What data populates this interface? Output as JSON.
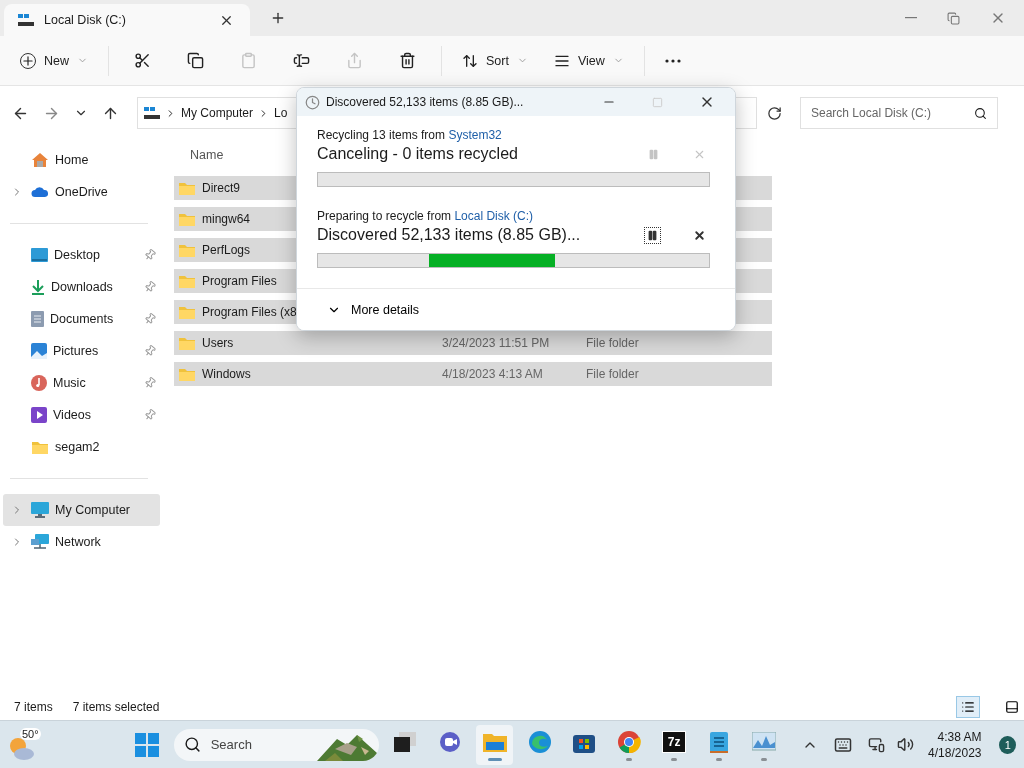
{
  "window": {
    "tab_title": "Local Disk (C:)"
  },
  "toolbar": {
    "new_label": "New",
    "tools": [
      {
        "disabled": false
      },
      {
        "disabled": false
      },
      {
        "disabled": true
      },
      {
        "disabled": false
      },
      {
        "disabled": true
      },
      {
        "disabled": false
      }
    ],
    "sort_label": "Sort",
    "view_label": "View"
  },
  "address": {
    "crumbs": [
      "My Computer",
      "Lo"
    ]
  },
  "search": {
    "placeholder": "Search Local Disk (C:)"
  },
  "sidebar": {
    "groups": [
      [
        {
          "label": "Home",
          "pinned": false,
          "selected": false,
          "has_children": false
        },
        {
          "label": "OneDrive",
          "pinned": false,
          "selected": false,
          "has_children": true
        }
      ],
      [
        {
          "label": "Desktop",
          "pinned": true,
          "selected": false,
          "has_children": false
        },
        {
          "label": "Downloads",
          "pinned": true,
          "selected": false,
          "has_children": false
        },
        {
          "label": "Documents",
          "pinned": true,
          "selected": false,
          "has_children": false
        },
        {
          "label": "Pictures",
          "pinned": true,
          "selected": false,
          "has_children": false
        },
        {
          "label": "Music",
          "pinned": true,
          "selected": false,
          "has_children": false
        },
        {
          "label": "Videos",
          "pinned": true,
          "selected": false,
          "has_children": false
        },
        {
          "label": "segam2",
          "pinned": false,
          "selected": false,
          "has_children": false
        }
      ],
      [
        {
          "label": "My Computer",
          "pinned": false,
          "selected": true,
          "has_children": true
        },
        {
          "label": "Network",
          "pinned": false,
          "selected": false,
          "has_children": true
        }
      ]
    ]
  },
  "file_list": {
    "columns": [
      "Name"
    ],
    "rows": [
      {
        "name": "Direct9",
        "selected": true
      },
      {
        "name": "mingw64",
        "selected": true
      },
      {
        "name": "PerfLogs",
        "selected": true
      },
      {
        "name": "Program Files",
        "selected": true
      },
      {
        "name": "Program Files (x8",
        "selected": true
      },
      {
        "name": "Users",
        "date": "3/24/2023 11:51 PM",
        "type": "File folder",
        "selected": true
      },
      {
        "name": "Windows",
        "date": "4/18/2023 4:13 AM",
        "type": "File folder",
        "selected": true
      }
    ]
  },
  "status_bar": {
    "item_count": "7 items",
    "selection": "7 items selected",
    "views": [
      {
        "selected": true
      },
      {
        "selected": false
      }
    ]
  },
  "dialog": {
    "title": "Discovered 52,133 items (8.85 GB)...",
    "operations": [
      {
        "source_prefix": "Recycling 13 items from",
        "source_link": "System32",
        "status": "Canceling - 0 items recycled",
        "indeterminate": false,
        "disabled": true
      },
      {
        "source_prefix": "Preparing to recycle from",
        "source_link": "Local Disk (C:)",
        "status": "Discovered 52,133 items (8.85 GB)...",
        "indeterminate": true,
        "disabled": false
      }
    ],
    "more_details": "More details"
  },
  "taskbar": {
    "weather": "50°",
    "search_placeholder": "Search",
    "apps": [
      {
        "running": false,
        "selected": false
      },
      {
        "running": false,
        "selected": false
      },
      {
        "running": true,
        "selected": true
      },
      {
        "running": false,
        "selected": false
      },
      {
        "running": false,
        "selected": false
      },
      {
        "running": true,
        "selected": false
      },
      {
        "running": true,
        "selected": false,
        "label": "7z"
      },
      {
        "running": true,
        "selected": false
      },
      {
        "running": true,
        "selected": false
      }
    ],
    "time": "4:38 AM",
    "date": "4/18/2023",
    "notifications": "1"
  }
}
